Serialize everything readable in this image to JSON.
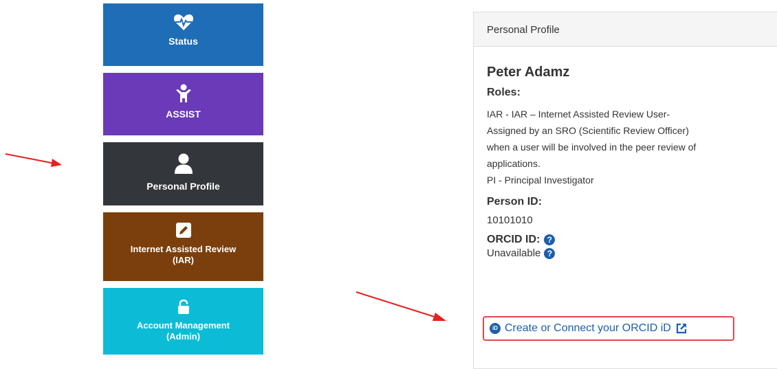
{
  "tiles": {
    "status": {
      "label": "Status",
      "icon": "heart-pulse-icon",
      "color": "#1f6db6"
    },
    "assist": {
      "label": "ASSIST",
      "icon": "child-icon",
      "color": "#6a3ab8"
    },
    "profile": {
      "label": "Personal Profile",
      "icon": "user-icon",
      "color": "#33363b"
    },
    "iar": {
      "label_line1": "Internet Assisted Review",
      "label_line2": "(IAR)",
      "icon": "pencil-square-icon",
      "color": "#7b3f0d"
    },
    "account": {
      "label_line1": "Account Management",
      "label_line2": "(Admin)",
      "icon": "unlock-icon",
      "color": "#0cbcd6"
    }
  },
  "panel": {
    "header": "Personal Profile",
    "name": "Peter Adamz",
    "roles_label": "Roles:",
    "roles_line1": "IAR - IAR – Internet Assisted Review User-",
    "roles_line2": "Assigned by an SRO (Scientific Review Officer)",
    "roles_line3": "when a user will be involved in the peer review of",
    "roles_line4": "applications.",
    "roles_line5": "PI - Principal Investigator",
    "person_id_label": "Person ID:",
    "person_id_value": "10101010",
    "orcid_label": "ORCID ID:",
    "orcid_status": "Unavailable",
    "orcid_link": "Create or Connect your ORCID iD",
    "orcid_badge": "iD"
  },
  "colors": {
    "link": "#1d5faa",
    "highlight": "#e2474c",
    "arrow": "#e8201f"
  }
}
